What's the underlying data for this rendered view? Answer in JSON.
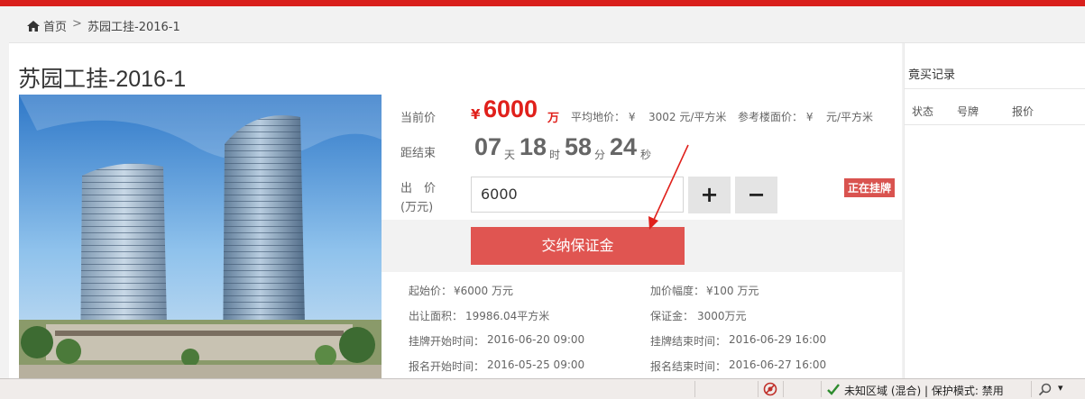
{
  "breadcrumb": {
    "home": "首页",
    "separator": ">",
    "current": "苏园工挂-2016-1"
  },
  "listing": {
    "title": "苏园工挂-2016-1",
    "current_price_label": "当前价",
    "currency_symbol": "¥",
    "current_price": "6000",
    "price_unit": "万",
    "avg_price_label": "平均地价： ¥",
    "avg_price": "3002 元/平方米",
    "ref_price_label": "参考楼面价： ¥",
    "ref_price": "元/平方米",
    "countdown_label": "距结束",
    "countdown": {
      "days": "07",
      "days_unit": "天",
      "hours": "18",
      "hours_unit": "时",
      "minutes": "58",
      "minutes_unit": "分",
      "seconds": "24",
      "seconds_unit": "秒"
    },
    "bid_label": "出　价",
    "bid_unit_label": "(万元)",
    "bid_value": "6000",
    "plus_label": "+",
    "minus_label": "−",
    "status_badge": "正在挂牌",
    "deposit_button": "交纳保证金"
  },
  "details": [
    {
      "label": "起始价：",
      "value": "¥6000  万元"
    },
    {
      "label": "加价幅度：",
      "value": "¥100  万元"
    },
    {
      "label": "出让面积：",
      "value": "19986.04平方米"
    },
    {
      "label": "保证金：",
      "value": "3000万元"
    },
    {
      "label": "挂牌开始时间：",
      "value": "2016-06-20 09:00"
    },
    {
      "label": "挂牌结束时间：",
      "value": "2016-06-29 16:00"
    },
    {
      "label": "报名开始时间：",
      "value": "2016-05-25 09:00"
    },
    {
      "label": "报名结束时间：",
      "value": "2016-06-27 16:00"
    }
  ],
  "bid_records": {
    "title": "竟买记录",
    "columns": [
      "状态",
      "号牌",
      "报价"
    ]
  },
  "statusbar": {
    "zone": "未知区域 (混合) | 保护模式: 禁用",
    "zoom_symbol": "▾"
  },
  "colors": {
    "brand_red": "#d9201c",
    "price_red": "#e0201b",
    "button_red": "#e05551"
  }
}
